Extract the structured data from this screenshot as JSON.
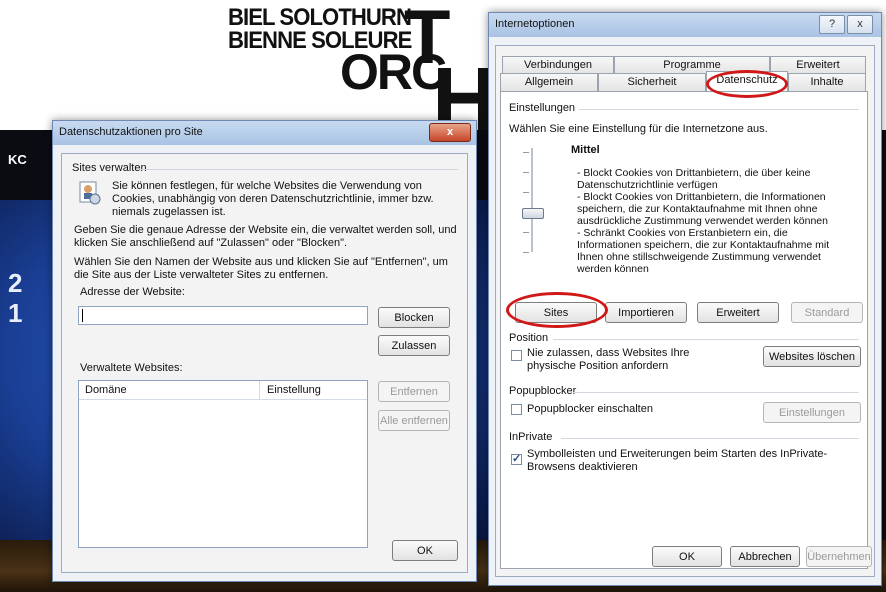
{
  "background": {
    "logo_line1": "BIEL SOLOTHURN",
    "logo_line2": "BIENNE SOLEURE",
    "logo_orc": "ORC",
    "logo_big_t": "T",
    "logo_big_h": "H",
    "strip_text": "KC",
    "side_letters": [
      "2",
      "1"
    ],
    "accent_ring": "#d01818"
  },
  "sites_dialog": {
    "title": "Datenschutzaktionen pro Site",
    "close_label": "x",
    "group_manage": "Sites verwalten",
    "intro_text": "Sie können festlegen, für welche Websites die Verwendung von Cookies, unabhängig von deren Datenschutzrichtlinie, immer bzw. niemals zugelassen ist.",
    "instruction1": "Geben Sie die genaue Adresse der Website ein, die verwaltet werden soll, und klicken Sie anschließend auf \"Zulassen\" oder \"Blocken\".",
    "instruction2": "Wählen Sie den Namen der Website aus und klicken Sie auf \"Entfernen\", um die Site aus der Liste verwalteter Sites zu entfernen.",
    "address_label": "Adresse der Website:",
    "address_value": "",
    "block_button": "Blocken",
    "allow_button": "Zulassen",
    "managed_label": "Verwaltete Websites:",
    "col_domain": "Domäne",
    "col_setting": "Einstellung",
    "remove_button": "Entfernen",
    "remove_all_button": "Alle entfernen",
    "ok_button": "OK"
  },
  "inet_options": {
    "title": "Internetoptionen",
    "help_label": "?",
    "close_label": "x",
    "tabs_row1": [
      "Verbindungen",
      "Programme",
      "Erweitert"
    ],
    "tabs_row2": [
      "Allgemein",
      "Sicherheit",
      "Datenschutz",
      "Inhalte"
    ],
    "active_tab": "Datenschutz",
    "settings_group": "Einstellungen",
    "settings_intro": "Wählen Sie eine Einstellung für die Internetzone aus.",
    "level_name": "Mittel",
    "level_desc": [
      "- Blockt Cookies von Drittanbietern, die über keine Datenschutzrichtlinie verfügen",
      "- Blockt Cookies von Drittanbietern, die Informationen speichern, die zur Kontaktaufnahme mit Ihnen ohne ausdrückliche Zustimmung verwendet werden können",
      "- Schränkt Cookies von Erstanbietern ein, die Informationen speichern, die zur Kontaktaufnahme mit Ihnen ohne stillschweigende Zustimmung verwendet werden können"
    ],
    "btn_sites": "Sites",
    "btn_import": "Importieren",
    "btn_advanced": "Erweitert",
    "btn_standard": "Standard",
    "position_group": "Position",
    "position_check": "Nie zulassen, dass Websites Ihre physische Position anfordern",
    "position_checked": false,
    "btn_clear_sites": "Websites löschen",
    "popup_group": "Popupblocker",
    "popup_check": "Popupblocker einschalten",
    "popup_checked": false,
    "btn_popup_settings": "Einstellungen",
    "inprivate_group": "InPrivate",
    "inprivate_check": "Symbolleisten und Erweiterungen beim Starten des InPrivate-Browsens deaktivieren",
    "inprivate_checked": true,
    "btn_ok": "OK",
    "btn_cancel": "Abbrechen",
    "btn_apply": "Übernehmen"
  }
}
